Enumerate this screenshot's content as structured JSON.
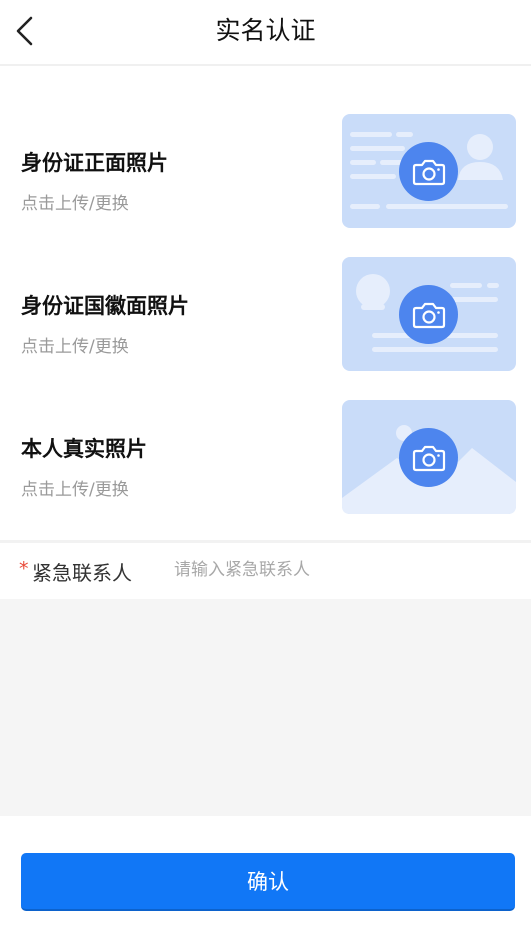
{
  "header": {
    "title": "实名认证",
    "back_icon": "chevron-left-icon"
  },
  "uploads": [
    {
      "label": "身份证正面照片",
      "hint": "点击上传/更换",
      "icon": "camera-icon"
    },
    {
      "label": "身份证国徽面照片",
      "hint": "点击上传/更换",
      "icon": "camera-icon"
    },
    {
      "label": "本人真实照片",
      "hint": "点击上传/更换",
      "icon": "camera-icon"
    }
  ],
  "contact": {
    "required_mark": "*",
    "label": "紧急联系人",
    "placeholder": "请输入紧急联系人",
    "value": ""
  },
  "confirm_label": "确认",
  "colors": {
    "accent": "#1177f6",
    "card_bg": "#c9dcf9",
    "camera": "#4d85ee",
    "required": "#e94a3a"
  }
}
